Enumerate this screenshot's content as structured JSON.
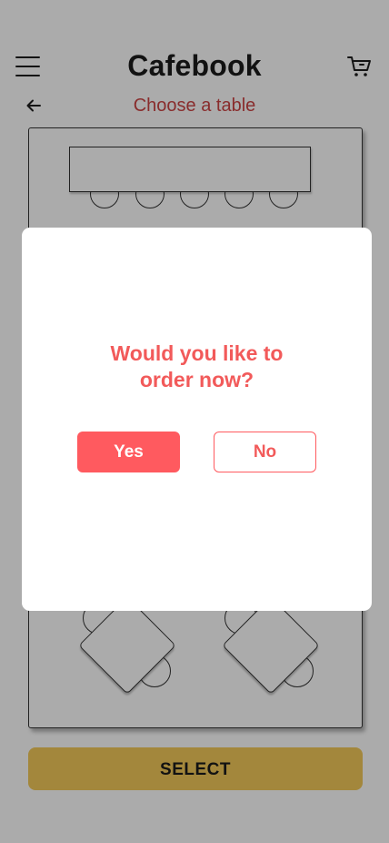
{
  "header": {
    "title": "Cafebook",
    "subtitle": "Choose a table",
    "menu_icon": "hamburger-menu-icon",
    "cart_icon": "shopping-cart-icon",
    "back_icon": "arrow-left-icon"
  },
  "floor_plan": {
    "bar_stools": 5,
    "diamond_tables": 2
  },
  "actions": {
    "select_label": "SELECT"
  },
  "dialog": {
    "message_line1": "Would you like to",
    "message_line2": "order now?",
    "yes_label": "Yes",
    "no_label": "No"
  },
  "colors": {
    "accent_red": "#ff5a5f",
    "select_yellow": "#f4c95a",
    "subtitle_red": "#cc4444"
  }
}
